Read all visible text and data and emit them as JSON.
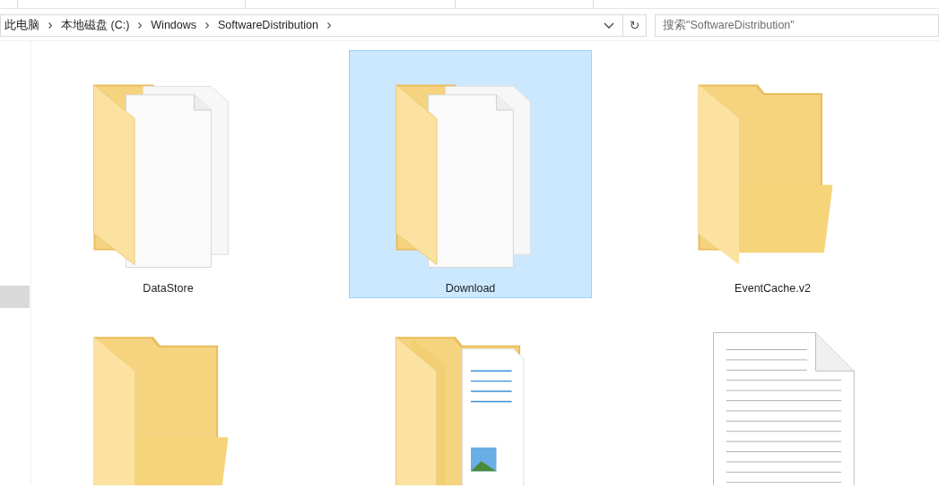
{
  "address_bar": {
    "segments": [
      "此电脑",
      "本地磁盘 (C:)",
      "Windows",
      "SoftwareDistribution"
    ],
    "refresh": "↻"
  },
  "search": {
    "placeholder": "搜索\"SoftwareDistribution\""
  },
  "nav_pane": {
    "items": [
      {
        "selected": true
      }
    ]
  },
  "items": [
    {
      "kind": "docs-folder",
      "label": "DataStore",
      "selected": false
    },
    {
      "kind": "docs-folder",
      "label": "Download",
      "selected": true
    },
    {
      "kind": "folder",
      "label": "EventCache.v2",
      "selected": false
    },
    {
      "kind": "folder",
      "selected": false
    },
    {
      "kind": "media-folder",
      "selected": false
    },
    {
      "kind": "file",
      "selected": false
    }
  ]
}
